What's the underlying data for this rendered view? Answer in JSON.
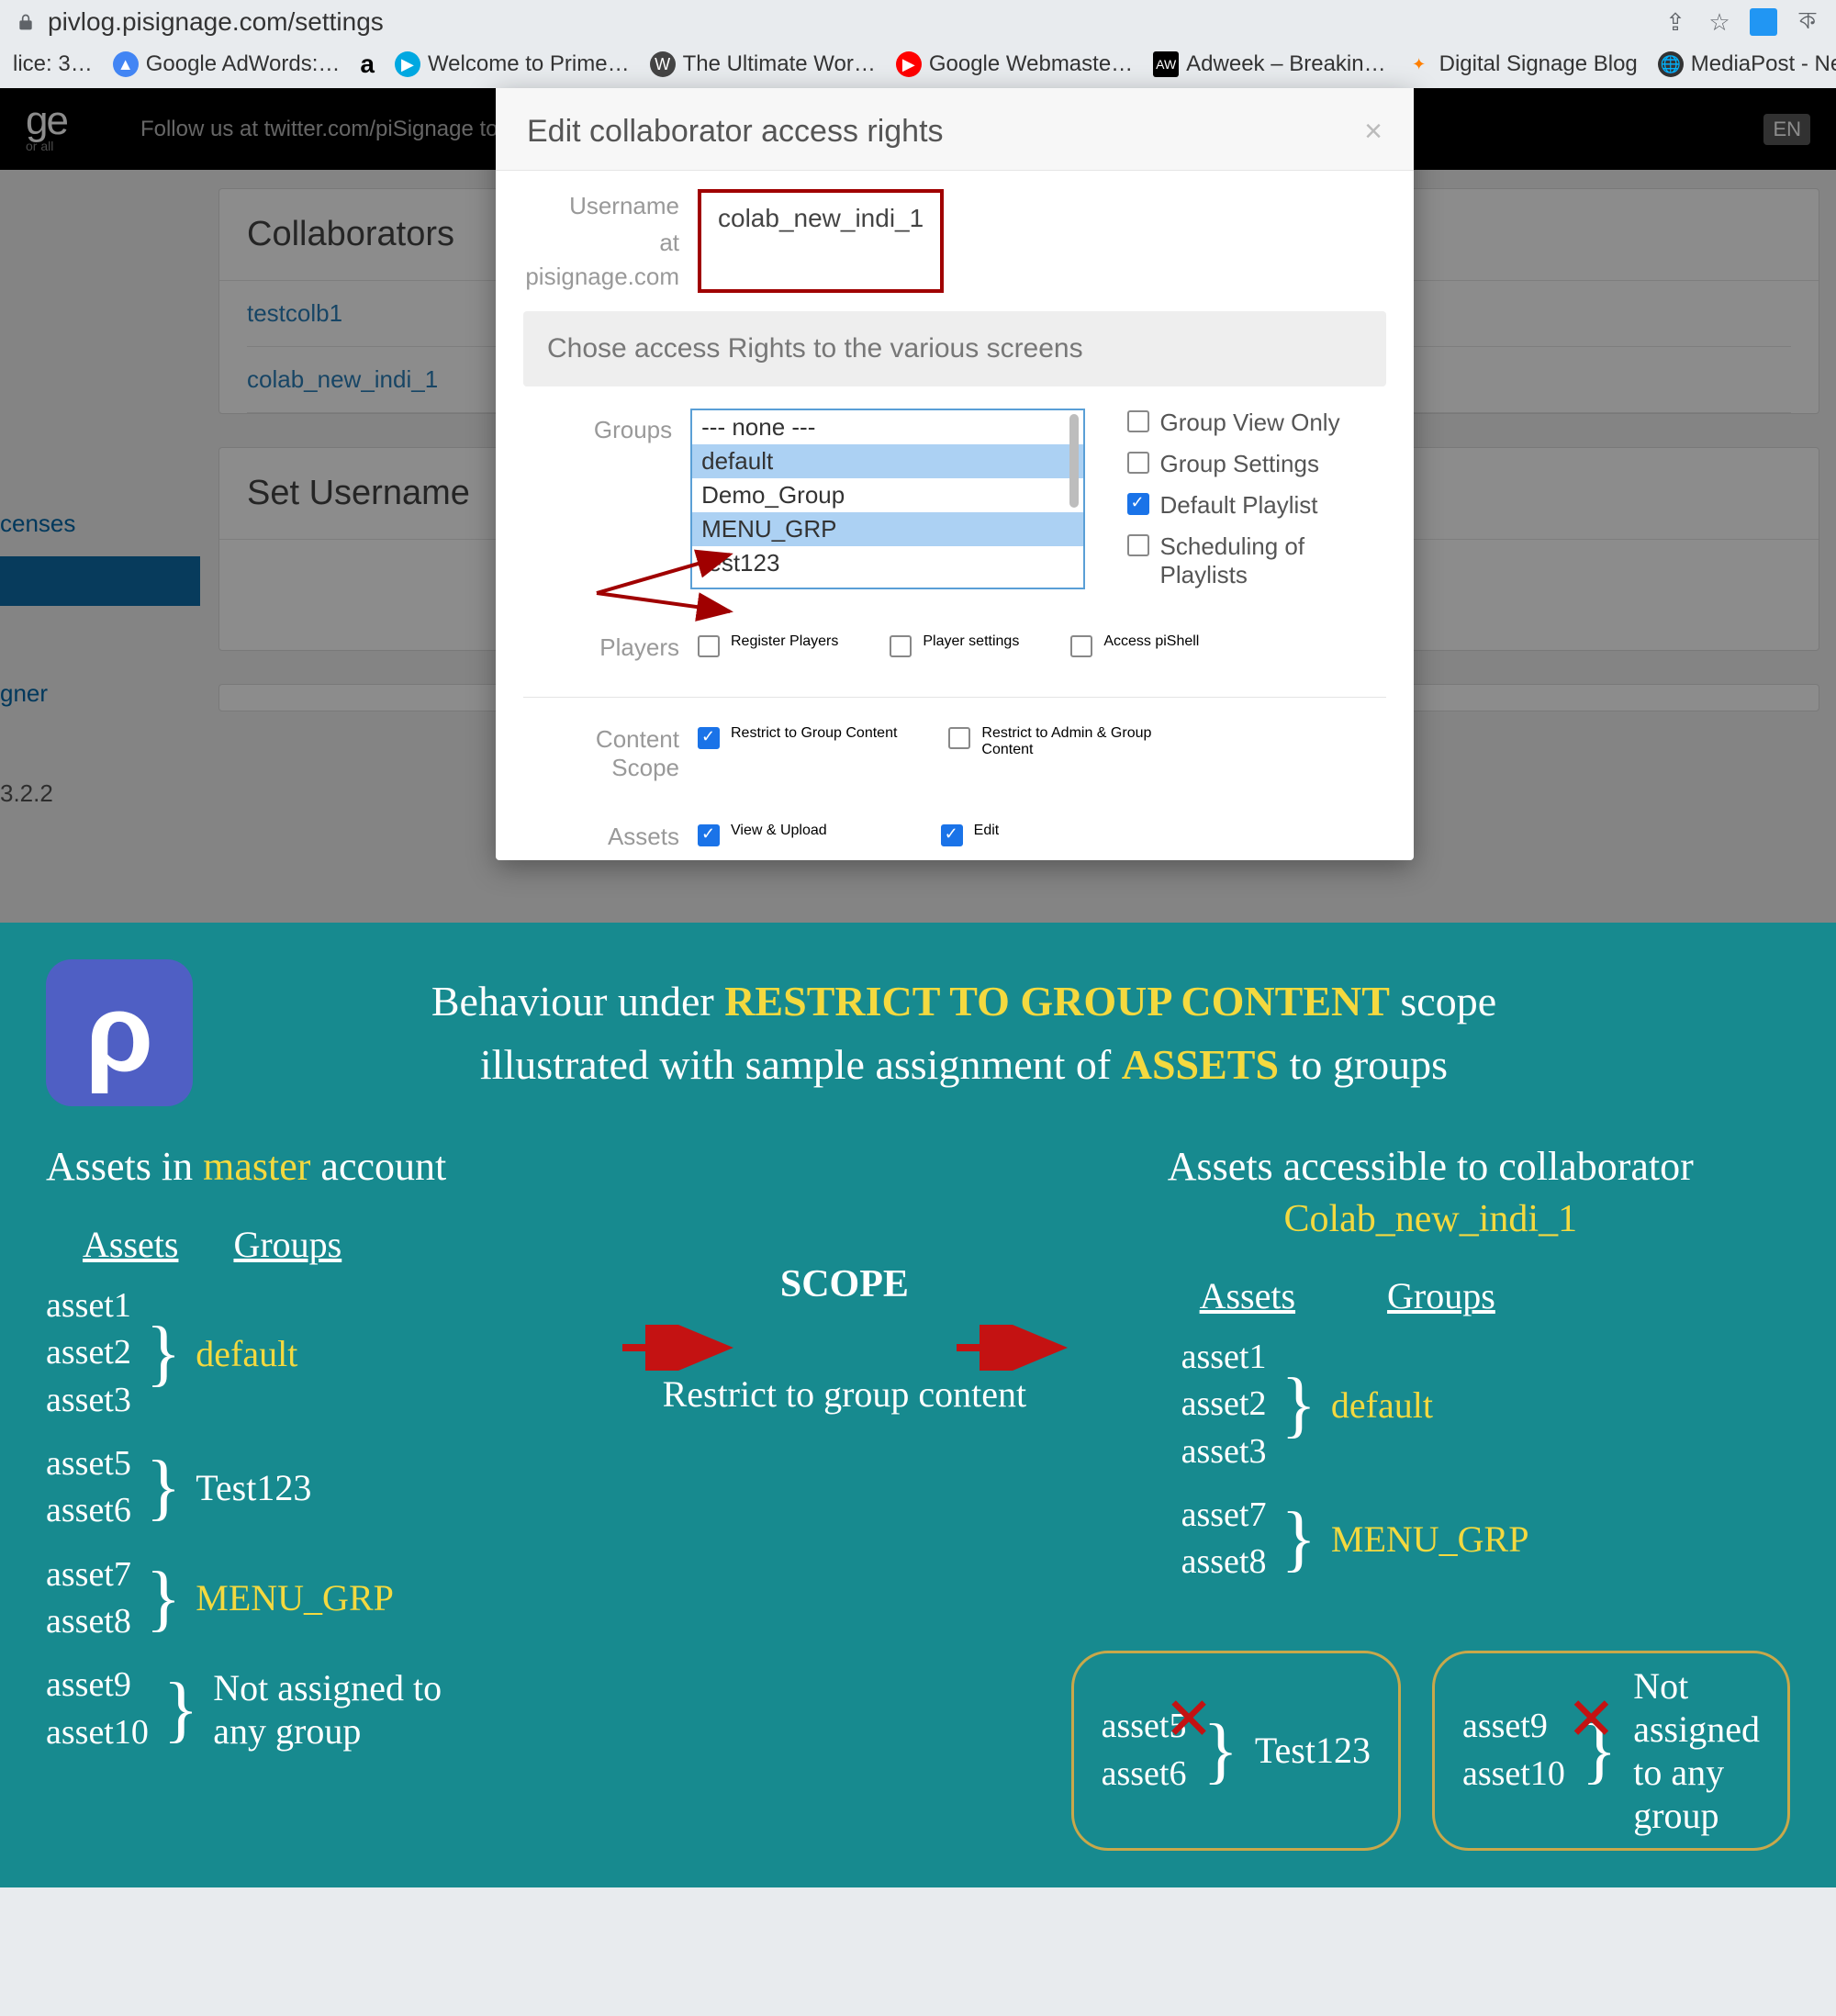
{
  "browser": {
    "url": "pivlog.pisignage.com/settings",
    "bookmarks": [
      {
        "label": "lice: 3…"
      },
      {
        "label": "Google AdWords:…"
      },
      {
        "label": "a"
      },
      {
        "label": "Welcome to Prime…"
      },
      {
        "label": "The Ultimate Wor…"
      },
      {
        "label": "Google Webmaste…"
      },
      {
        "label": "Adweek – Breakin…"
      },
      {
        "label": "Digital Signage Blog"
      },
      {
        "label": "MediaPost - News…"
      }
    ],
    "lang_badge": "EN"
  },
  "header": {
    "logo": "ge",
    "logo_sub": "or all",
    "twitter": "Follow us at twitter.com/piSignage to get the la"
  },
  "sidebar": {
    "licenses": "censes",
    "gner": "gner",
    "ver": "3.2.2"
  },
  "panels": {
    "collab_title": "Collaborators",
    "collab1": "testcolb1",
    "collab2": "colab_new_indi_1",
    "setuser": "Set Username"
  },
  "modal": {
    "title": "Edit collaborator access rights",
    "username_label": "Username",
    "at_label": "at pisignage.com",
    "username_value": "colab_new_indi_1",
    "access_prompt": "Chose access Rights to the various screens",
    "groups_label": "Groups",
    "group_opts": {
      "none": "--- none ---",
      "default": "default",
      "demo": "Demo_Group",
      "menu": "MENU_GRP",
      "test": "test123"
    },
    "grp_checks": {
      "view": "Group View Only",
      "settings": "Group Settings",
      "defpl": "Default Playlist",
      "sched": "Scheduling of Playlists"
    },
    "players_label": "Players",
    "players": {
      "reg": "Register Players",
      "set": "Player settings",
      "shell": "Access piShell"
    },
    "scope_label": "Content Scope",
    "scope": {
      "grp": "Restrict to Group Content",
      "admin": "Restrict to Admin & Group Content"
    },
    "assets_label": "Assets",
    "assets": {
      "view": "View & Upload",
      "edit": "Edit"
    }
  },
  "info": {
    "head1a": "Behaviour under ",
    "head1b": "RESTRICT TO GROUP CONTENT",
    "head1c": " scope",
    "head2a": "illustrated with sample assignment of ",
    "head2b": "ASSETS",
    "head2c": " to groups",
    "left_title_a": "Assets in ",
    "left_title_b": "master",
    "left_title_c": " account",
    "assets_h": "Assets",
    "groups_h": "Groups",
    "a1": "asset1",
    "a2": "asset2",
    "a3": "asset3",
    "a5": "asset5",
    "a6": "asset6",
    "a7": "asset7",
    "a8": "asset8",
    "a9": "asset9",
    "a10": "asset10",
    "g_default": "default",
    "g_test": "Test123",
    "g_menu": "MENU_GRP",
    "g_none": "Not assigned to any group",
    "scope_t": "SCOPE",
    "scope_s": "Restrict to group content",
    "right_title": "Assets accessible to collaborator",
    "collab_name": "Colab_new_indi_1",
    "excl_a5": "asset5",
    "excl_a6": "asset6",
    "excl_test": "Test123",
    "excl_a9": "asset9",
    "excl_a10": "asset10",
    "excl_none": "Not assigned to any group"
  }
}
